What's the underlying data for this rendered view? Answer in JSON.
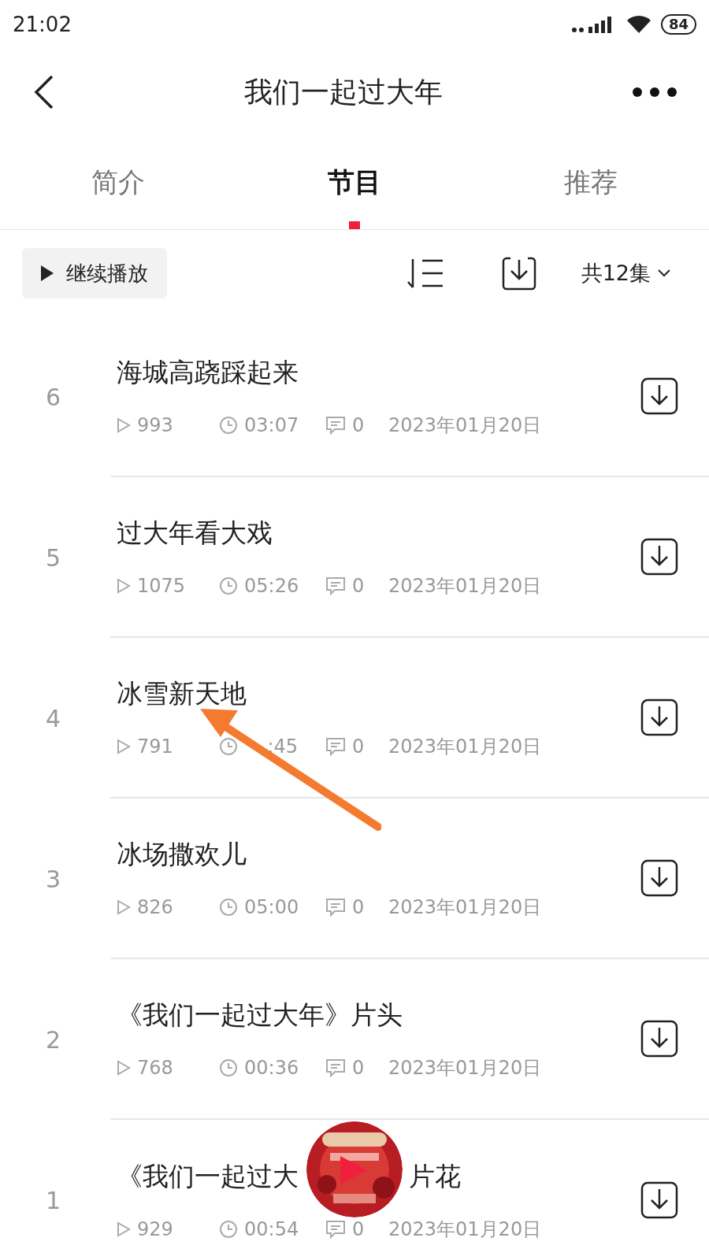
{
  "status_bar": {
    "time": "21:02",
    "battery": "84"
  },
  "header": {
    "title": "我们一起过大年"
  },
  "tabs": [
    {
      "label": "简介",
      "selected": false
    },
    {
      "label": "节目",
      "selected": true
    },
    {
      "label": "推荐",
      "selected": false
    }
  ],
  "toolbar": {
    "continue_button": "继续播放",
    "episode_count": "共12集"
  },
  "episodes": [
    {
      "number": "6",
      "title": "海城高跷踩起来",
      "plays": "993",
      "duration": "03:07",
      "comments": "0",
      "date": "2023年01月20日"
    },
    {
      "number": "5",
      "title": "过大年看大戏",
      "plays": "1075",
      "duration": "05:26",
      "comments": "0",
      "date": "2023年01月20日"
    },
    {
      "number": "4",
      "title": "冰雪新天地",
      "plays": "791",
      "duration": ":45",
      "comments": "0",
      "date": "2023年01月20日"
    },
    {
      "number": "3",
      "title": "冰场撒欢儿",
      "plays": "826",
      "duration": "05:00",
      "comments": "0",
      "date": "2023年01月20日"
    },
    {
      "number": "2",
      "title": "《我们一起过大年》片头",
      "plays": "768",
      "duration": "00:36",
      "comments": "0",
      "date": "2023年01月20日"
    },
    {
      "number": "1",
      "title": "《我们一起过大",
      "title_tail": "片花",
      "plays": "929",
      "duration": "00:54",
      "comments": "0",
      "date": "2023年01月20日"
    }
  ]
}
